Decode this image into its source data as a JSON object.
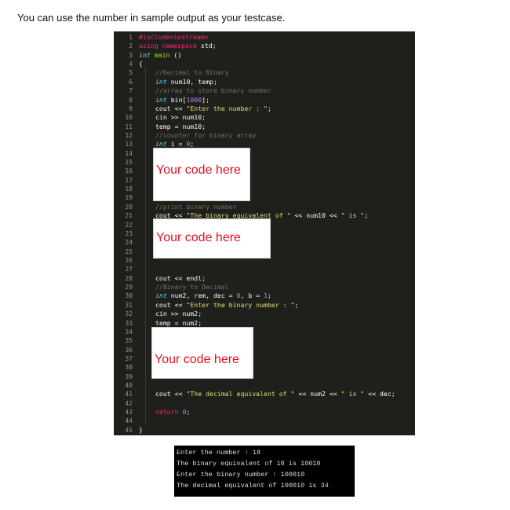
{
  "title": "You can use the number in sample output as your testcase.",
  "editor": {
    "lines": [
      {
        "i": 0,
        "t": [
          [
            "pp",
            "#include<iostream>"
          ]
        ]
      },
      {
        "i": 0,
        "t": [
          [
            "pp",
            "using namespace"
          ],
          [
            "",
            "std;"
          ]
        ]
      },
      {
        "i": 0,
        "t": [
          [
            "kw",
            "int"
          ],
          [
            "fn",
            "main"
          ],
          [
            "",
            "()"
          ]
        ]
      },
      {
        "i": 0,
        "t": [
          [
            "",
            "{"
          ]
        ]
      },
      {
        "i": 1,
        "t": [
          [
            "cm",
            "//Decimal to Binary"
          ]
        ]
      },
      {
        "i": 1,
        "t": [
          [
            "kw",
            "int"
          ],
          [
            "",
            "num10, temp;"
          ]
        ]
      },
      {
        "i": 1,
        "t": [
          [
            "cm",
            "//array to store binary number"
          ]
        ]
      },
      {
        "i": 1,
        "t": [
          [
            "kw",
            "int"
          ],
          [
            "",
            "bin["
          ],
          [
            "num",
            "1000"
          ],
          [
            "",
            "];"
          ]
        ]
      },
      {
        "i": 1,
        "t": [
          [
            "",
            "cout <<"
          ],
          [
            "str",
            "\"Enter the number : \""
          ],
          [
            "",
            ";"
          ]
        ]
      },
      {
        "i": 1,
        "t": [
          [
            "",
            "cin >> num10;"
          ]
        ]
      },
      {
        "i": 1,
        "t": [
          [
            "",
            "temp = num10;"
          ]
        ]
      },
      {
        "i": 1,
        "t": [
          [
            "cm",
            "//counter for binary array"
          ]
        ]
      },
      {
        "i": 1,
        "t": [
          [
            "kw",
            "int"
          ],
          [
            "",
            "i ="
          ],
          [
            "num",
            "0"
          ],
          [
            "",
            ";"
          ]
        ]
      },
      {
        "i": 1,
        "t": []
      },
      {
        "i": 1,
        "t": []
      },
      {
        "i": 1,
        "t": []
      },
      {
        "i": 1,
        "t": []
      },
      {
        "i": 1,
        "t": []
      },
      {
        "i": 1,
        "t": []
      },
      {
        "i": 1,
        "t": [
          [
            "cm",
            "//print binary number"
          ]
        ]
      },
      {
        "i": 1,
        "t": [
          [
            "",
            "cout <<"
          ],
          [
            "str",
            "\"The binary equivalent of \""
          ],
          [
            "",
            "<< num10 <<"
          ],
          [
            "str",
            "\" is \""
          ],
          [
            "",
            ";"
          ]
        ]
      },
      {
        "i": 1,
        "t": []
      },
      {
        "i": 1,
        "t": []
      },
      {
        "i": 1,
        "t": []
      },
      {
        "i": 1,
        "t": []
      },
      {
        "i": 1,
        "t": []
      },
      {
        "i": 1,
        "t": []
      },
      {
        "i": 1,
        "t": [
          [
            "",
            "cout << endl;"
          ]
        ]
      },
      {
        "i": 1,
        "t": [
          [
            "cm",
            "//Binary to Decimal"
          ]
        ]
      },
      {
        "i": 1,
        "t": [
          [
            "kw",
            "int"
          ],
          [
            "",
            "num2, rem, dec ="
          ],
          [
            "num",
            "0"
          ],
          [
            "",
            ", b ="
          ],
          [
            "num",
            "1"
          ],
          [
            "",
            ";"
          ]
        ]
      },
      {
        "i": 1,
        "t": [
          [
            "",
            "cout <<"
          ],
          [
            "str",
            "\"Enter the binary number : \""
          ],
          [
            "",
            ";"
          ]
        ]
      },
      {
        "i": 1,
        "t": [
          [
            "",
            "cin >> num2;"
          ]
        ]
      },
      {
        "i": 1,
        "t": [
          [
            "",
            "temp = num2;"
          ]
        ]
      },
      {
        "i": 1,
        "t": []
      },
      {
        "i": 1,
        "t": []
      },
      {
        "i": 1,
        "t": []
      },
      {
        "i": 1,
        "t": []
      },
      {
        "i": 1,
        "t": []
      },
      {
        "i": 1,
        "t": []
      },
      {
        "i": 1,
        "t": []
      },
      {
        "i": 1,
        "t": [
          [
            "",
            "cout <<"
          ],
          [
            "str",
            "\"The decimal equivalent of \""
          ],
          [
            "",
            "<< num2 <<"
          ],
          [
            "str",
            "\" is \""
          ],
          [
            "",
            "<< dec;"
          ]
        ]
      },
      {
        "i": 1,
        "t": []
      },
      {
        "i": 1,
        "t": [
          [
            "ret",
            "return"
          ],
          [
            "num",
            "0"
          ],
          [
            "",
            ";"
          ]
        ]
      },
      {
        "i": 1,
        "t": []
      },
      {
        "i": 0,
        "t": [
          [
            "",
            "}"
          ]
        ]
      }
    ],
    "placeholders": [
      "Your code here",
      "Your code here",
      "Your code here"
    ]
  },
  "console": {
    "lines": [
      "Enter the number : 18",
      "The binary equivalent of 18 is 10010",
      "Enter the binary number : 100010",
      "The decimal equivalent of 100010 is 34"
    ]
  }
}
